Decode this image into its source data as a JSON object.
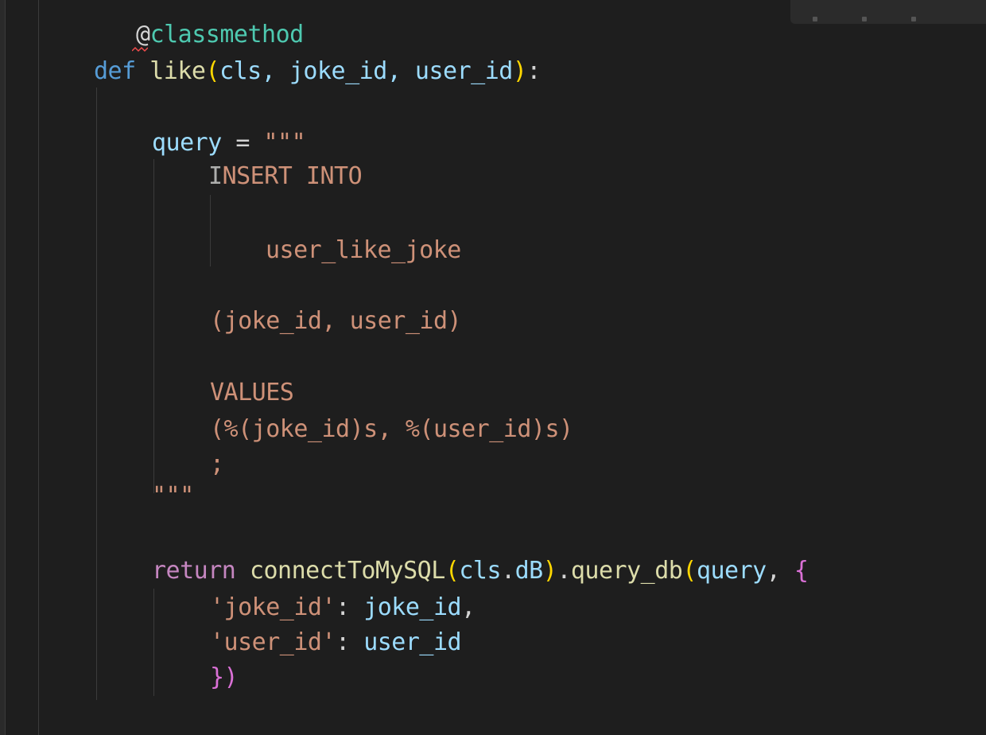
{
  "editor": {
    "language": "python",
    "decorator": "classmethod",
    "def_keyword": "def",
    "function_name": "like",
    "params": "cls, joke_id, user_id",
    "query_var": "query",
    "equals": "=",
    "triple_quote_open": "\"\"\"",
    "sql": {
      "line1_cursor": "I",
      "line1_rest": "NSERT INTO",
      "table": "user_like_joke",
      "columns": "(joke_id, user_id)",
      "values_kw": "VALUES",
      "values": "(%(joke_id)s, %(user_id)s)",
      "semicolon": ";"
    },
    "triple_quote_close": "\"\"\"",
    "return_keyword": "return",
    "call_func": "connectToMySQL",
    "call_arg_obj": "cls",
    "call_arg_attr": "dB",
    "method": "query_db",
    "method_arg": "query",
    "dict_key1": "'joke_id'",
    "dict_val1": "joke_id",
    "dict_key2": "'user_id'",
    "dict_val2": "user_id",
    "close": "})"
  },
  "colors": {
    "background": "#1e1e1e",
    "keyword": "#569cd6",
    "function": "#dcdcaa",
    "parameter": "#9cdcfe",
    "string": "#ce9178",
    "control": "#c586c0",
    "class": "#4ec9b0"
  }
}
